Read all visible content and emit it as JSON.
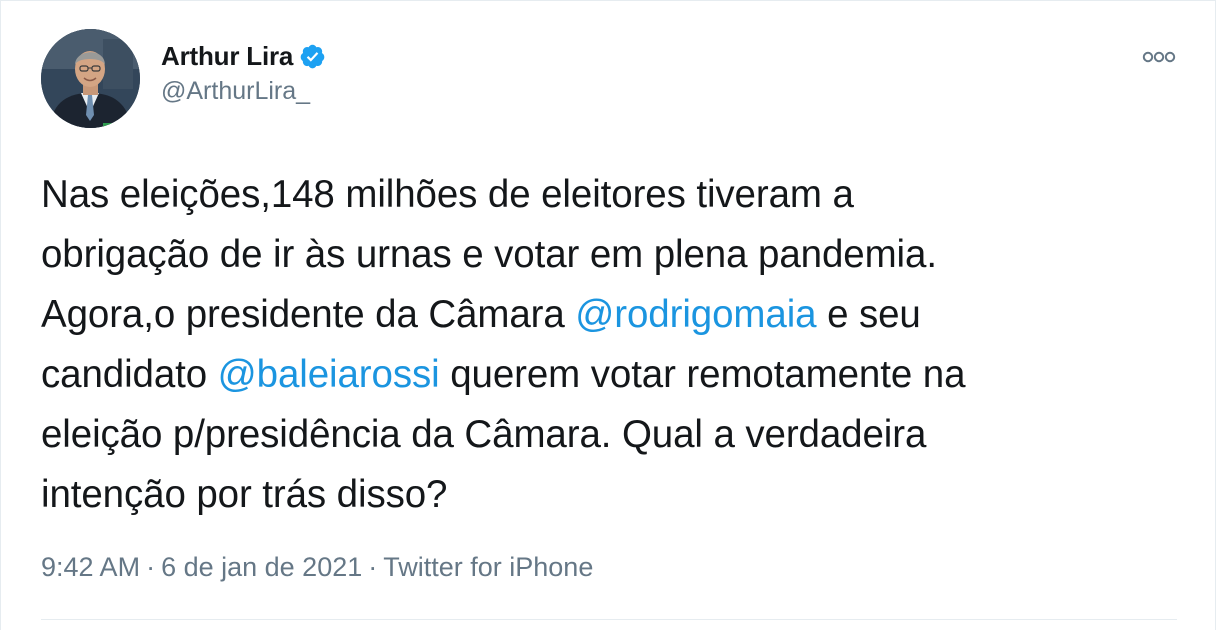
{
  "author": {
    "name": "Arthur Lira",
    "handle": "@ArthurLira_",
    "verified": true,
    "avatar_icon": "profile-photo"
  },
  "tweet": {
    "segments": [
      {
        "type": "text",
        "value": "Nas eleições,148 milhões de eleitores tiveram a"
      },
      {
        "type": "text",
        "value": "obrigação de ir às urnas e votar em plena pandemia."
      },
      {
        "type": "text",
        "value": "Agora,o presidente da Câmara "
      },
      {
        "type": "mention",
        "value": "@rodrigomaia"
      },
      {
        "type": "text",
        "value": " e seu"
      },
      {
        "type": "text",
        "value": "candidato "
      },
      {
        "type": "mention",
        "value": "@baleiarossi"
      },
      {
        "type": "text",
        "value": " querem votar remotamente na"
      },
      {
        "type": "text",
        "value": "eleição p/presidência da Câmara. Qual a verdadeira"
      },
      {
        "type": "text",
        "value": "intenção por trás disso?"
      }
    ]
  },
  "meta": {
    "time": "9:42 AM",
    "separator": "·",
    "date": "6 de jan de 2021",
    "source": "Twitter for iPhone"
  },
  "colors": {
    "text": "#14171a",
    "secondary": "#657786",
    "link": "#1b95e0",
    "verified": "#1da1f2"
  },
  "icons": {
    "verified": "verified-badge-icon",
    "more": "more-options-icon"
  }
}
